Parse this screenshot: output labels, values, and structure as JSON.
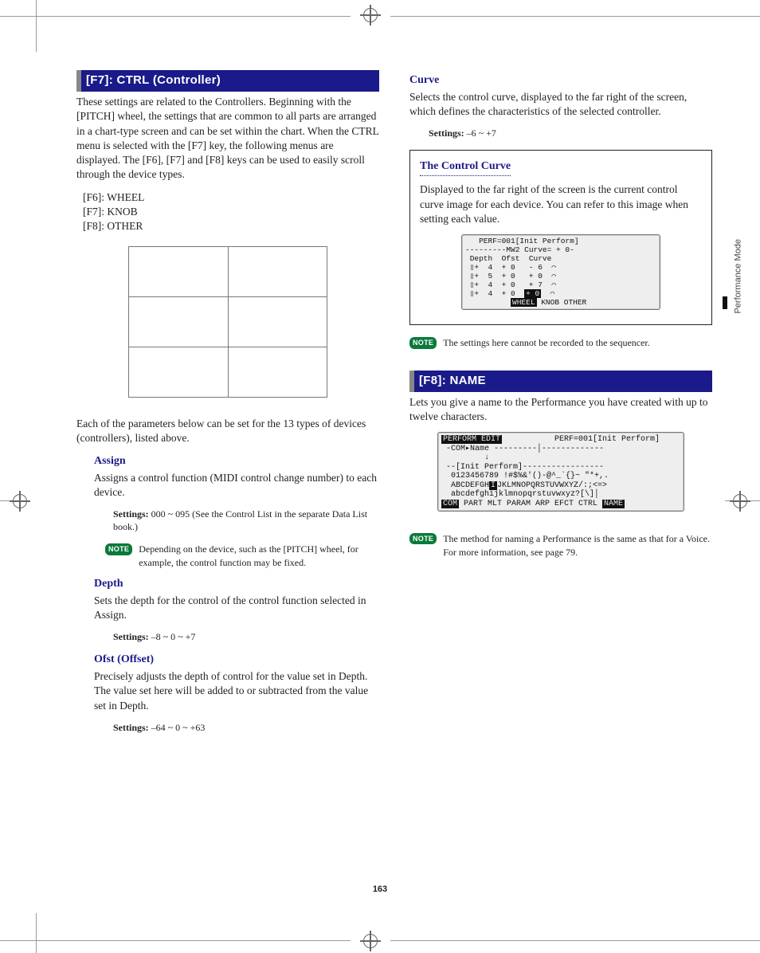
{
  "page_number": "163",
  "side_label": "Performance Mode",
  "left_col": {
    "f7_header": "[F7]: CTRL (Controller)",
    "f7_intro": "These settings are related to the Controllers. Beginning with the [PITCH] wheel, the settings that are common to all parts are arranged in a chart-type screen and can be set within the chart. When the CTRL menu is selected with the [F7] key, the following menus are displayed. The [F6], [F7] and [F8] keys can be used to easily scroll through the device types.",
    "fkey_list": [
      "[F6]: WHEEL",
      "[F7]: KNOB",
      "[F8]: OTHER"
    ],
    "below_chart": "Each of the parameters below can be set for the 13 types of devices (controllers), listed above.",
    "assign": {
      "title": "Assign",
      "body": "Assigns a control function (MIDI control change number) to each device.",
      "settings_label": "Settings:",
      "settings_value": "000 ~ 095 (See the Control List in the separate Data List book.)",
      "note": "Depending on the device, such as the [PITCH] wheel, for example, the control function may be fixed."
    },
    "depth": {
      "title": "Depth",
      "body": "Sets the depth for the control of the control function selected in Assign.",
      "settings_label": "Settings:",
      "settings_value": "–8 ~ 0 ~ +7"
    },
    "ofst": {
      "title": "Ofst (Offset)",
      "body": "Precisely adjusts the depth of control for the value set in Depth. The value set here will be added to or subtracted from the value set in Depth.",
      "settings_label": "Settings:",
      "settings_value": "–64 ~ 0 ~ +63"
    }
  },
  "right_col": {
    "curve": {
      "title": "Curve",
      "body": "Selects the control curve, displayed to the far right of the screen, which defines the characteristics of the selected controller.",
      "settings_label": "Settings:",
      "settings_value": "–6 ~ +7"
    },
    "inset": {
      "title": "The Control Curve",
      "body": "Displayed to the far right of the screen is the current control curve image for each device. You can refer to this image when setting each value.",
      "lcd_lines": [
        "   PERF=001[Init Perform]   ",
        "---------MW2 Curve= + 0-",
        " Depth  Ofst  Curve         ",
        " ▯+  4  + 0   - 6  ⌒        ",
        " ▯+  5  + 0   + 0  ⌒        ",
        " ▯+  4  + 0   + 7  ⌒        ",
        " ▯+  4  + 0  ",
        "          ",
        " KNOB OTHER"
      ],
      "lcd_inv_wheel": "WHEEL",
      "lcd_inv_val": "+ 0"
    },
    "note1": "The settings here cannot be recorded to the sequencer.",
    "f8_header": "[F8]: NAME",
    "f8_intro": "Lets you give a name to the Performance you have created with up to twelve characters.",
    "lcd2_lines": [
      "           PERF=001[Init Perform] ",
      " -COM▸Name ---------│------------- ",
      "         ↓                         ",
      " --[Init Perform]----------------- ",
      "  0123456789 !#$%&'()-@^_`{}~ \"*+,.",
      "  ABCDEFGHIJKLMNOPQRSTUVWXYZ/:;<=> ",
      "  abcdefghijklmnopqrstuvwxyz?[\\]│  ",
      " ",
      " PART MLT PARAM ARP EFCT CTRL "
    ],
    "lcd2_inv_edit": "PERFORM EDIT",
    "lcd2_inv_i": "I",
    "lcd2_inv_com": "COM",
    "lcd2_inv_name": "NAME",
    "note2": "The method for naming a Performance is the same as that for a Voice. For more information, see page 79."
  },
  "note_badge": "NOTE"
}
